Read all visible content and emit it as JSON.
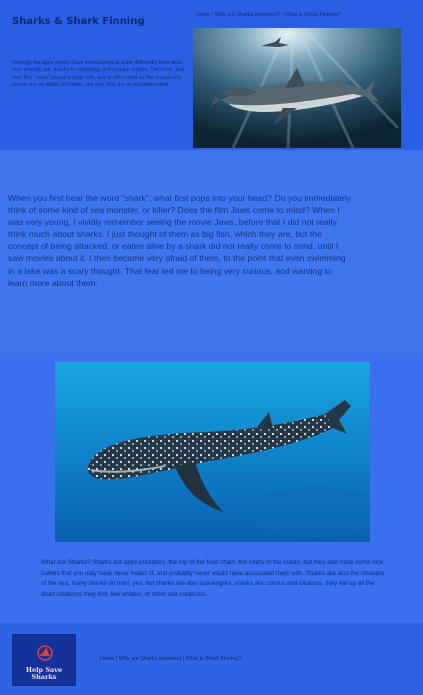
{
  "header": {
    "title": "Sharks & Shark Finning",
    "nav": [
      "Home",
      "Why are Sharks important?",
      "What is Shark Finning?"
    ],
    "intro": "Through the ages sharks have been looked at quite differently from what they actually are, thanks to mythology and popular culture. The book, and then film \"Jaws\" played a large role, and is often cited as the reason why people are so afraid of sharks, and why they are so misunderstood."
  },
  "hero_image": {
    "icon": "shark-photo"
  },
  "section2": {
    "text": "When you first hear the word \"shark\", what first pops into your head? Do you immediately think of some kind of sea monster, or killer? Does the film Jaws come to mind? When I was very young, I vividly remember seeing the movie Jaws, before that I did not really think much about sharks. I just thought of them as big fish, which they are, but the concept of being attacked, or eaten alive by a shark did not really come to mind, until I saw movies about it. I then became very afraid of them, to the point that even swimming in a lake was a scary thought. That fear led me to being very curious, and wanting to learn more about them."
  },
  "section3": {
    "image_icon": "whale-shark-photo",
    "text": "What are Sharks? Sharks are apex predators, the top of the food chain, the rulers of the ocean, but they also have some nick names that you may have never heard of, and probably never would have associated them with. Sharks are also the cleaners of the sea, many sharks do hunt, yes, but sharks are also scavengers, sharks are curious and cautious, they eat up all the dead creatures they find, like whales, or other sea creatures."
  },
  "footer": {
    "logo_text": "Help Save Sharks",
    "nav": [
      "Home",
      "Why are Sharks important",
      "What is Shark Finning?"
    ]
  }
}
